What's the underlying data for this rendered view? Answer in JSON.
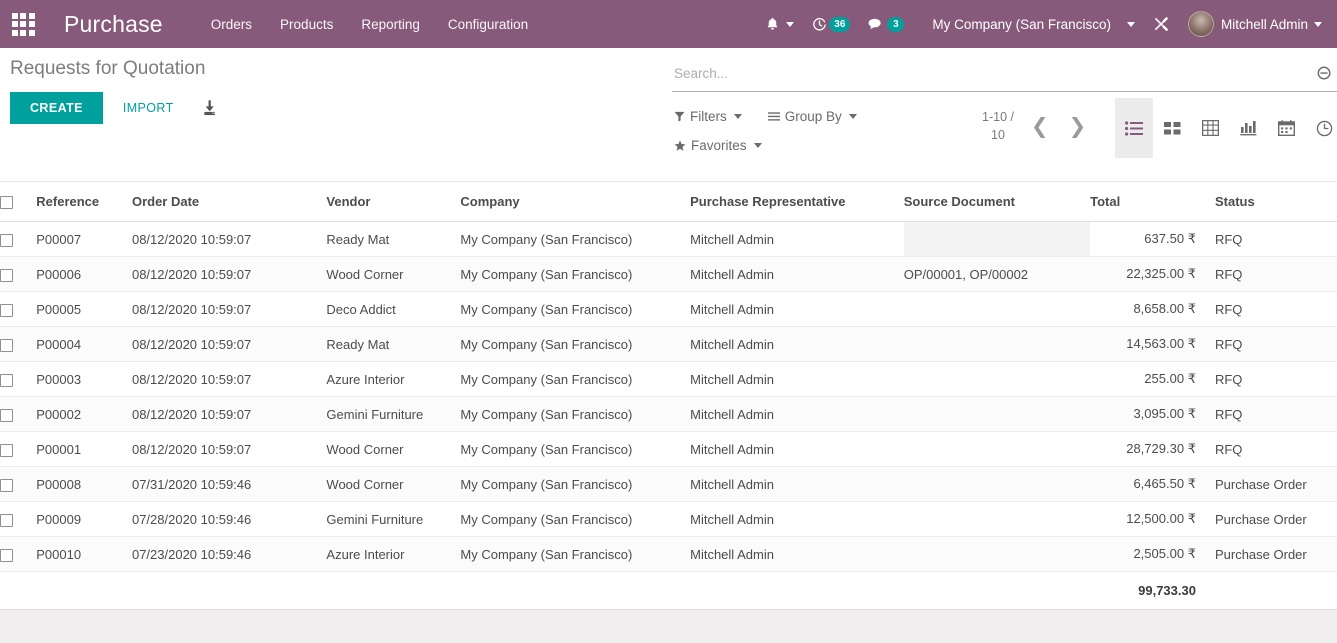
{
  "navbar": {
    "apps_icon": "apps-grid-icon",
    "brand": "Purchase",
    "menu": [
      {
        "label": "Orders"
      },
      {
        "label": "Products"
      },
      {
        "label": "Reporting"
      },
      {
        "label": "Configuration"
      }
    ],
    "systray": {
      "bell_icon": "bell-icon",
      "activity_icon": "clock-activity-icon",
      "activity_count": "36",
      "messages_icon": "messages-icon",
      "messages_count": "3",
      "company": "My Company (San Francisco)",
      "debug_icon": "bug-tools-icon",
      "avatar": "user-avatar",
      "user": "Mitchell Admin"
    },
    "colors": {
      "background": "#875A7B",
      "badge": "#00A09D"
    }
  },
  "control_panel": {
    "breadcrumb": "Requests for Quotation",
    "create_label": "CREATE",
    "import_label": "IMPORT",
    "export_icon": "download-export-icon",
    "colors": {
      "primary": "#00A09D"
    }
  },
  "search": {
    "placeholder": "Search...",
    "value": "",
    "toggle_icon": "search-minus-icon"
  },
  "filters": [
    {
      "label": "Filters",
      "icon": "filter-icon"
    },
    {
      "label": "Group By",
      "icon": "bars-icon"
    },
    {
      "label": "Favorites",
      "icon": "star-icon"
    }
  ],
  "pager": {
    "count": "1-10 / 10",
    "previous_icon": "chevron-left-icon",
    "next_icon": "chevron-right-icon"
  },
  "views": [
    {
      "name": "list",
      "icon": "list-view-icon",
      "active": true
    },
    {
      "name": "kanban",
      "icon": "kanban-view-icon",
      "active": false
    },
    {
      "name": "pivot",
      "icon": "pivot-view-icon",
      "active": false
    },
    {
      "name": "graph",
      "icon": "graph-view-icon",
      "active": false
    },
    {
      "name": "calendar",
      "icon": "calendar-view-icon",
      "active": false
    },
    {
      "name": "activity",
      "icon": "activity-clock-view-icon",
      "active": false
    }
  ],
  "table": {
    "columns": [
      "Reference",
      "Order Date",
      "Vendor",
      "Company",
      "Purchase Representative",
      "Source Document",
      "Total",
      "Status"
    ],
    "rows": [
      {
        "reference": "P00007",
        "order_date": "08/12/2020 10:59:07",
        "vendor": "Ready Mat",
        "company": "My Company (San Francisco)",
        "representative": "Mitchell Admin",
        "source_document": "",
        "total": "637.50",
        "currency": "₹",
        "status": "RFQ"
      },
      {
        "reference": "P00006",
        "order_date": "08/12/2020 10:59:07",
        "vendor": "Wood Corner",
        "company": "My Company (San Francisco)",
        "representative": "Mitchell Admin",
        "source_document": "OP/00001, OP/00002",
        "total": "22,325.00",
        "currency": "₹",
        "status": "RFQ"
      },
      {
        "reference": "P00005",
        "order_date": "08/12/2020 10:59:07",
        "vendor": "Deco Addict",
        "company": "My Company (San Francisco)",
        "representative": "Mitchell Admin",
        "source_document": "",
        "total": "8,658.00",
        "currency": "₹",
        "status": "RFQ"
      },
      {
        "reference": "P00004",
        "order_date": "08/12/2020 10:59:07",
        "vendor": "Ready Mat",
        "company": "My Company (San Francisco)",
        "representative": "Mitchell Admin",
        "source_document": "",
        "total": "14,563.00",
        "currency": "₹",
        "status": "RFQ"
      },
      {
        "reference": "P00003",
        "order_date": "08/12/2020 10:59:07",
        "vendor": "Azure Interior",
        "company": "My Company (San Francisco)",
        "representative": "Mitchell Admin",
        "source_document": "",
        "total": "255.00",
        "currency": "₹",
        "status": "RFQ"
      },
      {
        "reference": "P00002",
        "order_date": "08/12/2020 10:59:07",
        "vendor": "Gemini Furniture",
        "company": "My Company (San Francisco)",
        "representative": "Mitchell Admin",
        "source_document": "",
        "total": "3,095.00",
        "currency": "₹",
        "status": "RFQ"
      },
      {
        "reference": "P00001",
        "order_date": "08/12/2020 10:59:07",
        "vendor": "Wood Corner",
        "company": "My Company (San Francisco)",
        "representative": "Mitchell Admin",
        "source_document": "",
        "total": "28,729.30",
        "currency": "₹",
        "status": "RFQ"
      },
      {
        "reference": "P00008",
        "order_date": "07/31/2020 10:59:46",
        "vendor": "Wood Corner",
        "company": "My Company (San Francisco)",
        "representative": "Mitchell Admin",
        "source_document": "",
        "total": "6,465.50",
        "currency": "₹",
        "status": "Purchase Order"
      },
      {
        "reference": "P00009",
        "order_date": "07/28/2020 10:59:46",
        "vendor": "Gemini Furniture",
        "company": "My Company (San Francisco)",
        "representative": "Mitchell Admin",
        "source_document": "",
        "total": "12,500.00",
        "currency": "₹",
        "status": "Purchase Order"
      },
      {
        "reference": "P00010",
        "order_date": "07/23/2020 10:59:46",
        "vendor": "Azure Interior",
        "company": "My Company (San Francisco)",
        "representative": "Mitchell Admin",
        "source_document": "",
        "total": "2,505.00",
        "currency": "₹",
        "status": "Purchase Order"
      }
    ],
    "footer_total": "99,733.30"
  }
}
